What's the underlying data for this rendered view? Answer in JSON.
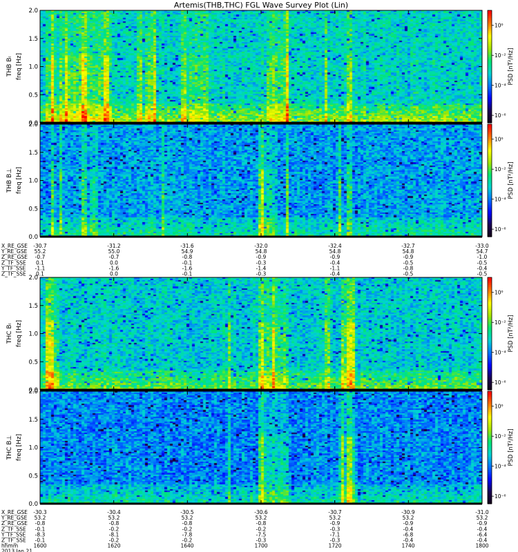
{
  "title": "Artemis(THB,THC) FGL Wave Survey Plot (Lin)",
  "colors": {
    "background": "#ffffff",
    "axis": "#000000",
    "colormap": [
      "#120012",
      "#1a0050",
      "#0000ff",
      "#0070ff",
      "#00d4d4",
      "#00e673",
      "#a6e600",
      "#ffff00",
      "#ff7a00",
      "#ff0000"
    ]
  },
  "orbit_labels_a": [
    "X_RE_GSE",
    "Y_RE_GSE",
    "Z_RE_GSE",
    "Z_TF_SSE",
    "Y_TF_SSE",
    "Z_TF_SSE"
  ],
  "orbit_rows_a": [
    [
      "-30.7",
      "-31.2",
      "-31.6",
      "-32.0",
      "-32.4",
      "-32.7",
      "-33.0"
    ],
    [
      "55.2",
      "55.0",
      "54.9",
      "54.8",
      "54.8",
      "54.8",
      "54.7"
    ],
    [
      "-0.7",
      "-0.7",
      "-0.8",
      "-0.9",
      "-0.9",
      "-0.9",
      "-1.0"
    ],
    [
      "0.1",
      "0.0",
      "-0.1",
      "-0.3",
      "-0.4",
      "-0.5",
      "-0.5"
    ],
    [
      "-1.1",
      "-1.6",
      "-1.6",
      "-1.4",
      "-1.1",
      "-0.8",
      "-0.4"
    ],
    [
      "0.1",
      "0.0",
      "-0.1",
      "-0.3",
      "-0.4",
      "-0.5",
      "-0.5"
    ]
  ],
  "orbit_labels_b": [
    "X_RE_GSE",
    "Y_RE_GSE",
    "Z_RE_GSE",
    "Z_TF_SSE",
    "Y_TF_SSE",
    "Z_TF_SSE",
    "hhmm",
    "2013 Jan 21"
  ],
  "orbit_rows_b": [
    [
      "-30.3",
      "-30.4",
      "-30.5",
      "-30.6",
      "-30.7",
      "-30.9",
      "-31.0"
    ],
    [
      "53.2",
      "53.2",
      "53.2",
      "53.2",
      "53.2",
      "53.2",
      "53.2"
    ],
    [
      "-0.8",
      "-0.8",
      "-0.8",
      "-0.8",
      "-0.9",
      "-0.9",
      "-0.9"
    ],
    [
      "-0.1",
      "-0.2",
      "-0.2",
      "-0.2",
      "-0.3",
      "-0.4",
      "-0.4"
    ],
    [
      "-8.3",
      "-8.1",
      "-7.8",
      "-7.5",
      "-7.1",
      "-6.8",
      "-6.4"
    ],
    [
      "-0.1",
      "-0.2",
      "-0.2",
      "-0.3",
      "-0.3",
      "-0.4",
      "-0.4"
    ],
    [
      "1600",
      "1620",
      "1640",
      "1700",
      "1720",
      "1740",
      "1800"
    ]
  ],
  "chart_data": [
    {
      "type": "heatmap",
      "panel": "THB B_L",
      "ylabel": "THB Bₗ\nfreq [Hz]",
      "ylabel_line1": "THB Bₗ",
      "ylabel_line2": "freq [Hz]",
      "y_ticks": [
        "0.0",
        "0.5",
        "1.0",
        "1.5",
        "2.0"
      ],
      "ylim": [
        0,
        2
      ],
      "colorbar_label": "PSD [nT²/Hz]",
      "colorbar_ticks": [
        "10⁰",
        "10⁻²",
        "10⁻⁴",
        "10⁻⁶"
      ],
      "colorbar_range": [
        -6.5,
        1
      ],
      "background_log_psd": -3.0,
      "low_freq_log_psd": -1.8,
      "enhanced_bands": [
        [
          1602,
          1608
        ],
        [
          1610,
          1626
        ],
        [
          1626,
          1632
        ],
        [
          1648,
          1652
        ],
        [
          1668,
          1676
        ],
        [
          1702,
          1712
        ]
      ],
      "spikes_min": [
        1606,
        1609,
        1612,
        1620,
        1630,
        1645,
        1652,
        1665,
        1712,
        1729,
        1740
      ]
    },
    {
      "type": "heatmap",
      "panel": "THB B_perp",
      "ylabel": "THB B⊥\nfreq [Hz]",
      "ylabel_line1": "THB B⊥",
      "ylabel_line2": "freq [Hz]",
      "y_ticks": [
        "0.0",
        "0.5",
        "1.0",
        "1.5",
        "2.0"
      ],
      "ylim": [
        0,
        2
      ],
      "colorbar_label": "PSD [nT²/Hz]",
      "colorbar_ticks": [
        "10⁰",
        "10⁻²",
        "10⁻⁴",
        "10⁻⁶"
      ],
      "colorbar_range": [
        -6.5,
        1
      ],
      "background_log_psd": -3.6,
      "low_freq_log_psd": -3.0,
      "enhanced_bands": [
        [
          1622,
          1626
        ],
        [
          1700,
          1708
        ]
      ],
      "spikes_min": [
        1606,
        1609,
        1620,
        1656,
        1700,
        1712,
        1736,
        1740
      ]
    },
    {
      "type": "heatmap",
      "panel": "THC B_L",
      "ylabel": "THC Bₗ\nfreq [Hz]",
      "ylabel_line1": "THC Bₗ",
      "ylabel_line2": "freq [Hz]",
      "y_ticks": [
        "0.0",
        "0.5",
        "1.0",
        "1.5",
        "2.0"
      ],
      "ylim": [
        0,
        2
      ],
      "colorbar_label": "PSD [nT²/Hz]",
      "colorbar_ticks": [
        "10⁰",
        "10⁻²",
        "10⁻⁴",
        "10⁻⁶"
      ],
      "colorbar_range": [
        -6.5,
        1
      ],
      "background_log_psd": -3.1,
      "low_freq_log_psd": -2.2,
      "enhanced_bands": [
        [
          1603,
          1609
        ],
        [
          1700,
          1712
        ],
        [
          1737,
          1743
        ]
      ],
      "spikes_min": [
        1603,
        1605,
        1686,
        1700,
        1706,
        1730,
        1737,
        1740,
        1742
      ]
    },
    {
      "type": "heatmap",
      "panel": "THC B_perp",
      "ylabel": "THC B⊥\nfreq [Hz]",
      "ylabel_line1": "THC B⊥",
      "ylabel_line2": "freq [Hz]",
      "y_ticks": [
        "0.0",
        "0.5",
        "1.0",
        "1.5",
        "2.0"
      ],
      "ylim": [
        0,
        2
      ],
      "colorbar_label": "PSD [nT²/Hz]",
      "colorbar_ticks": [
        "10⁰",
        "10⁻²",
        "10⁻⁴",
        "10⁻⁶"
      ],
      "colorbar_range": [
        -6.5,
        1
      ],
      "background_log_psd": -3.8,
      "low_freq_log_psd": -3.1,
      "enhanced_bands": [
        [
          1700,
          1712
        ],
        [
          1735,
          1742
        ]
      ],
      "spikes_min": [
        1686,
        1700,
        1737,
        1740
      ]
    }
  ]
}
